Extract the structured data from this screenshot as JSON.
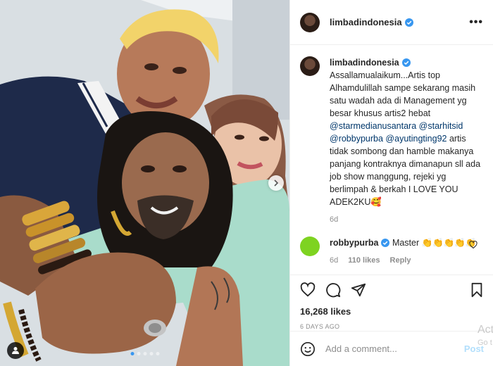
{
  "post": {
    "username": "limbadindonesia",
    "more_label": "•••"
  },
  "caption": {
    "username": "limbadindonesia",
    "text_1": "Assallamualaikum...Artis top Alhamdulillah sampe sekarang masih satu wadah ada di Management yg besar khusus artis2 hebat ",
    "mention_1": "@starmedianusantara",
    "mention_2": "@starhitsid",
    "mention_3": "@robbypurba",
    "mention_4": "@ayutingting92",
    "text_2": " artis tidak sombong dan hamble makanya panjang kontraknya dimanapun sll ada job show manggung, rejeki yg berlimpah & berkah I LOVE YOU ADEK2KU🥰",
    "age": "6d"
  },
  "reply": {
    "username": "robbypurba",
    "text": "Master 👏👏👏👏👏",
    "age": "6d",
    "likes": "110 likes",
    "reply_label": "Reply"
  },
  "stats": {
    "likes": "16,268 likes",
    "time": "6 DAYS AGO"
  },
  "comment_box": {
    "placeholder": "Add a comment...",
    "post_label": "Post"
  },
  "watermark": {
    "line1": "Act",
    "line2": "Go t"
  },
  "carousel": {
    "total_dots": 5,
    "active_index": 0
  }
}
